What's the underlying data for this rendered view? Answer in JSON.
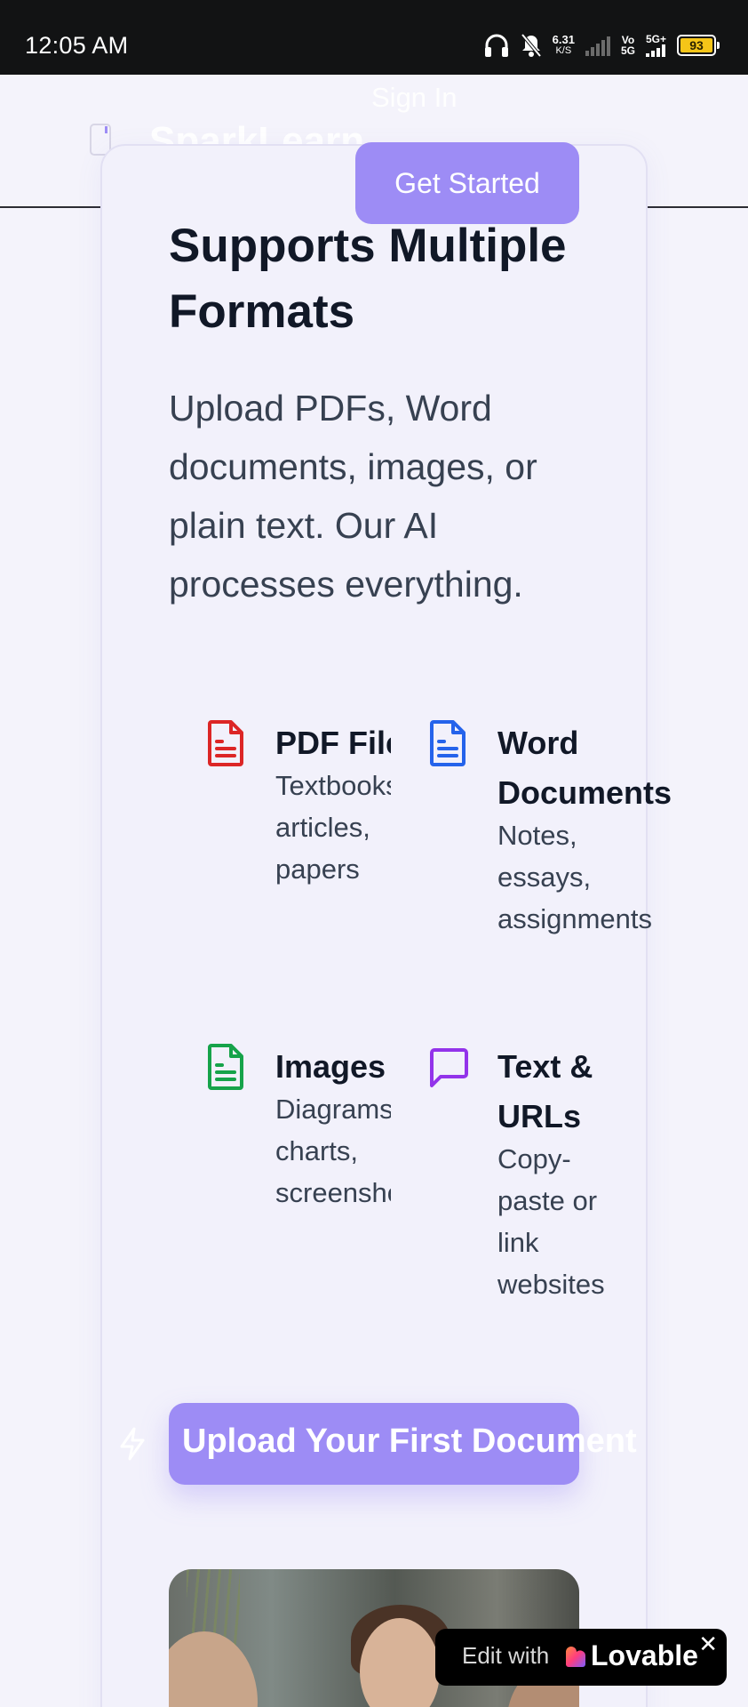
{
  "status_bar": {
    "time": "12:05 AM",
    "net_speed": "6.31",
    "net_unit": "K/S",
    "network_label_top": "Vo",
    "network_label_bottom": "5G",
    "network_type": "5G+",
    "battery": "93"
  },
  "header": {
    "brand": "SparkLearn",
    "sign_in_label": "Sign In",
    "get_started_label": "Get Started"
  },
  "section": {
    "title": "Supports Multiple Formats",
    "description": "Upload PDFs, Word documents, images, or plain text. Our AI processes everything."
  },
  "formats": [
    {
      "title": "PDF Files",
      "description": "Textbooks, articles, papers",
      "icon": "pdf-file-icon",
      "color": "#dc2626"
    },
    {
      "title": "Word Documents",
      "description": "Notes, essays, assignments",
      "icon": "word-file-icon",
      "color": "#2563eb"
    },
    {
      "title": "Images",
      "description": "Diagrams, charts, screenshots",
      "icon": "image-file-icon",
      "color": "#16a34a"
    },
    {
      "title": "Text & URLs",
      "description": "Copy-paste or link websites",
      "icon": "chat-bubble-icon",
      "color": "#9333ea"
    }
  ],
  "cta": {
    "upload_label": "Upload Your First Document"
  },
  "badge": {
    "edit_with": "Edit with",
    "brand": "Lovable",
    "close": "✕"
  },
  "colors": {
    "accent": "#9d8cf5",
    "background": "#f4f3fb",
    "heading": "#111827",
    "body_text": "#374151"
  }
}
